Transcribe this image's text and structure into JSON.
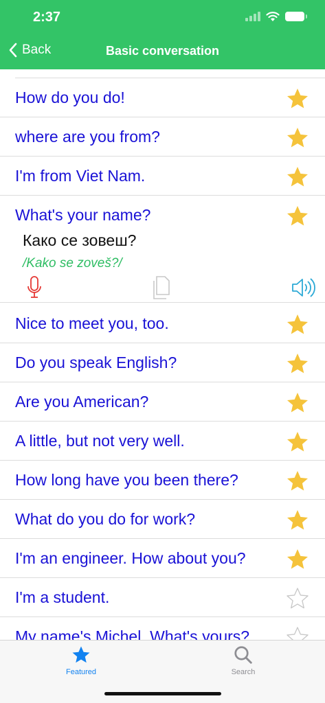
{
  "status_bar": {
    "time": "2:37"
  },
  "nav": {
    "back_label": "Back",
    "title": "Basic conversation"
  },
  "phrases": [
    {
      "text": "How do you do!",
      "starred": true
    },
    {
      "text": "where are you from?",
      "starred": true
    },
    {
      "text": "I'm from Viet Nam.",
      "starred": true
    },
    {
      "text": "What's your name?",
      "starred": true,
      "translation": "Како се зовеш?",
      "pronunciation": "/Kako se zoveš?/"
    },
    {
      "text": "Nice to meet you, too.",
      "starred": true
    },
    {
      "text": "Do you speak English?",
      "starred": true
    },
    {
      "text": "Are you American?",
      "starred": true
    },
    {
      "text": "A little, but not very well.",
      "starred": true
    },
    {
      "text": "How long have you been there?",
      "starred": true
    },
    {
      "text": "What do you do for work?",
      "starred": true
    },
    {
      "text": "I'm an engineer. How about you?",
      "starred": true
    },
    {
      "text": "I'm a student.",
      "starred": false
    },
    {
      "text": "My name's Michel. What's yours?",
      "starred": false
    }
  ],
  "tabs": [
    {
      "label": "Featured",
      "icon": "star-icon",
      "active": true
    },
    {
      "label": "Search",
      "icon": "search-icon",
      "active": false
    }
  ],
  "colors": {
    "header": "#33c467",
    "phrase": "#1a12d6",
    "star": "#f5c33b",
    "accent": "#1282f0"
  }
}
